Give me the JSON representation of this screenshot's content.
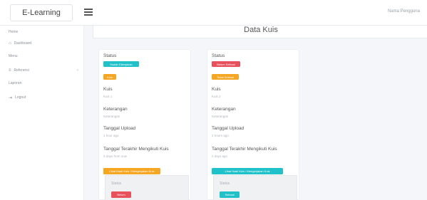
{
  "app": {
    "brand": "E-Learning",
    "user_link": "Nama Pengguna"
  },
  "sidebar": {
    "sections": [
      {
        "head": "Home",
        "items": [
          {
            "label": "Dashboard",
            "icon": "home-icon",
            "chevron": ""
          }
        ]
      },
      {
        "head": "Menu",
        "items": [
          {
            "label": "Referensi",
            "icon": "list-icon",
            "chevron": "‹"
          }
        ]
      },
      {
        "head": "Laporan",
        "items": [
          {
            "label": "Logout",
            "icon": "logout-icon",
            "chevron": ""
          }
        ]
      }
    ]
  },
  "main": {
    "title": "Data Kuis"
  },
  "cards": [
    {
      "status_label": "Status",
      "status_badge": "Sudah Dikerjakan",
      "status_color": "#20c1c9",
      "tag": "Kuis",
      "tag_color": "#f5a623",
      "kuis_label": "Kuis",
      "kuis_value": "Kuis 1",
      "ket_label": "Keterangan",
      "ket_value": "Keterangan",
      "upload_label": "Tanggal Upload",
      "upload_value": "1 hour ago",
      "deadline_label": "Tanggal Terakhir Mengikuti Kuis",
      "deadline_value": "3 days from now",
      "action_button": "Lihat Hasil Kuis / Mengerjakan Kuis",
      "action_color": "#f5a623",
      "inner_label": "Status",
      "inner_badge": "Belum",
      "inner_color": "#e8505b"
    },
    {
      "status_label": "Status",
      "status_badge": "Belum Selesai",
      "status_color": "#e8505b",
      "tag": "Tidak Selesai",
      "tag_color": "#f5a623",
      "kuis_label": "Kuis",
      "kuis_value": "Kuis 2",
      "ket_label": "Keterangan",
      "ket_value": "Keterangan",
      "upload_label": "Tanggal Upload",
      "upload_value": "2 hours ago",
      "deadline_label": "Tanggal Terakhir Mengikuti Kuis",
      "deadline_value": "2 days ago",
      "action_button": "Lihat Hasil Kuis / Mengerjakan Kuis",
      "action_color": "#20c1c9",
      "inner_label": "Status",
      "inner_badge": "Selesai",
      "inner_color": "#20c1c9"
    }
  ]
}
